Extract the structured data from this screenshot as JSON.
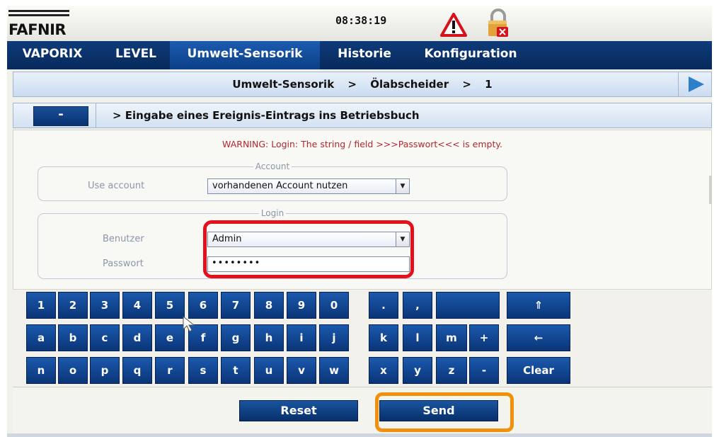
{
  "header": {
    "logo": "FAFNIR",
    "clock": "08:38:19",
    "icons": [
      "warning-triangle-icon",
      "lock-error-icon"
    ]
  },
  "nav": {
    "tabs": [
      {
        "label": "VAPORIX",
        "active": false
      },
      {
        "label": "LEVEL",
        "active": false
      },
      {
        "label": "Umwelt-Sensorik",
        "active": true
      },
      {
        "label": "Historie",
        "active": false
      },
      {
        "label": "Konfiguration",
        "active": false
      }
    ]
  },
  "breadcrumb": {
    "items": [
      "Umwelt-Sensorik",
      "Ölabscheider",
      "1"
    ],
    "separator": ">"
  },
  "section": {
    "collapse_label": "-",
    "title": "> Eingabe eines Ereignis-Eintrags ins Betriebsbuch"
  },
  "form": {
    "warning": "WARNING: Login: The string / field >>>Passwort<<< is empty.",
    "account": {
      "legend": "Account",
      "use_account_label": "Use account",
      "use_account_value": "vorhandenen Account nutzen"
    },
    "login": {
      "legend": "Login",
      "user_label": "Benutzer",
      "user_value": "Admin",
      "password_label": "Passwort",
      "password_value": "••••••••"
    }
  },
  "keyboard": {
    "row1": [
      "1",
      "2",
      "3",
      "4",
      "5",
      "6",
      "7",
      "8",
      "9",
      "0",
      ".",
      ",",
      "",
      "⇑"
    ],
    "row2": [
      "a",
      "b",
      "c",
      "d",
      "e",
      "f",
      "g",
      "h",
      "i",
      "j",
      "k",
      "l",
      "m",
      "+",
      "←"
    ],
    "row3": [
      "n",
      "o",
      "p",
      "q",
      "r",
      "s",
      "t",
      "u",
      "v",
      "w",
      "x",
      "y",
      "z",
      "-",
      "Clear"
    ]
  },
  "actions": {
    "reset_label": "Reset",
    "send_label": "Send"
  },
  "colors": {
    "nav_blue": "#0e3b7a",
    "key_blue": "#1b59ad",
    "warning_red": "#b2282e",
    "highlight_red": "#e3111c",
    "highlight_orange": "#f2900b"
  }
}
